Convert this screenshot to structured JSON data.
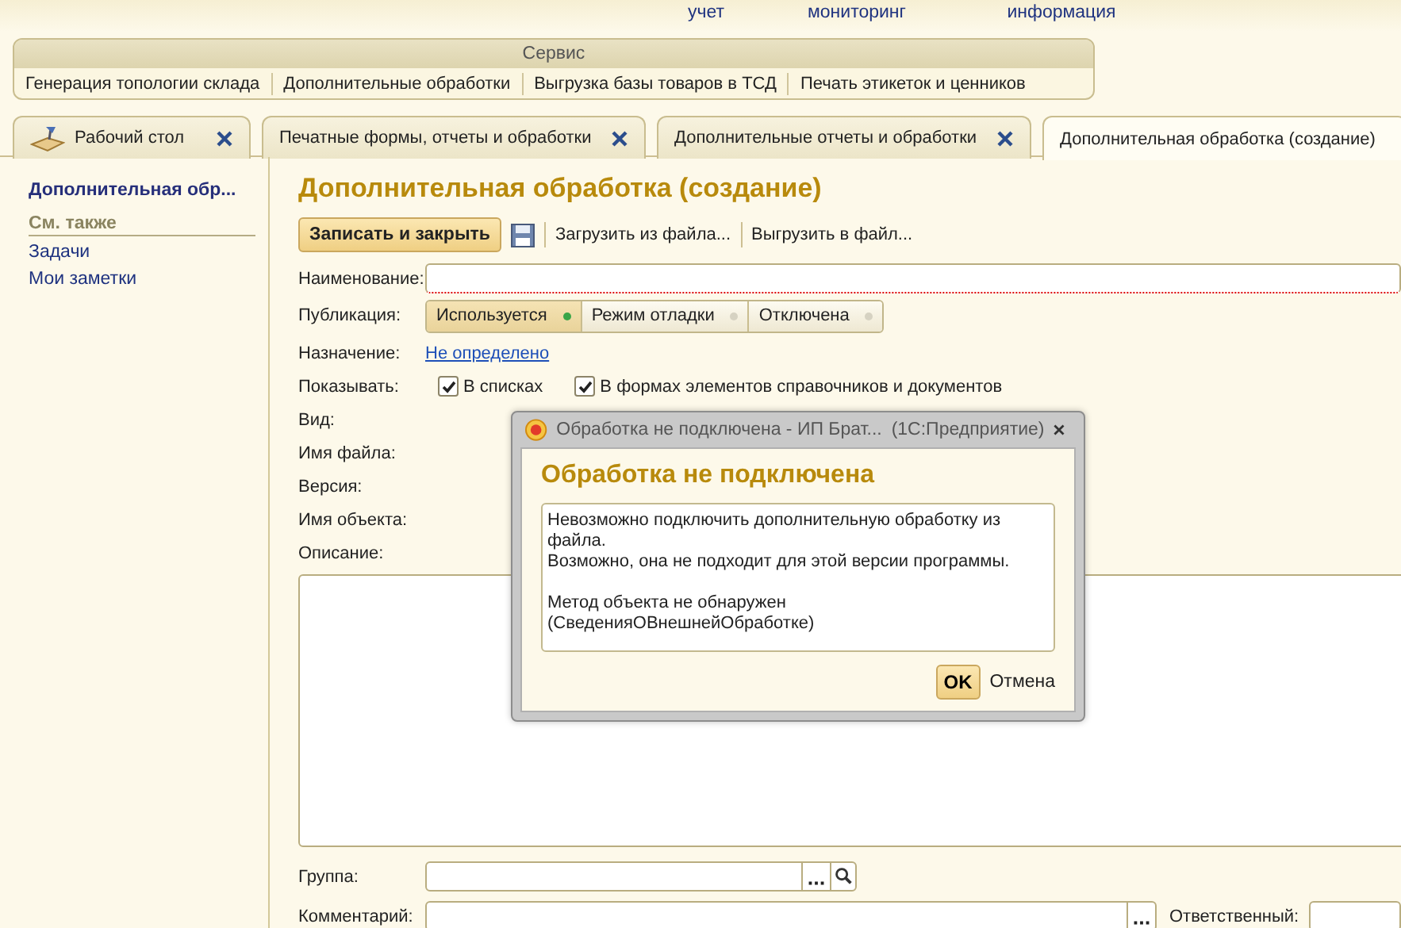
{
  "top_menu": [
    {
      "label": "учет"
    },
    {
      "label": "мониторинг"
    },
    {
      "label": "информация"
    }
  ],
  "service_panel": {
    "title": "Сервис",
    "items": [
      "Генерация топологии склада",
      "Дополнительные обработки",
      "Выгрузка базы товаров в ТСД",
      "Печать этикеток и ценников"
    ]
  },
  "tabs": [
    {
      "label": "Рабочий стол",
      "kind": "desktop",
      "selected": false,
      "closable": true
    },
    {
      "label": "Печатные формы, отчеты и обработки",
      "kind": "form",
      "selected": false,
      "closable": true
    },
    {
      "label": "Дополнительные отчеты и обработки",
      "kind": "form",
      "selected": false,
      "closable": true
    },
    {
      "label": "Дополнительная обработка (создание)",
      "kind": "form",
      "selected": true,
      "closable": false
    }
  ],
  "sidebar": {
    "title": "Дополнительная обр...",
    "section": "См. также",
    "items": [
      "Задачи",
      "Мои заметки"
    ]
  },
  "form": {
    "title": "Дополнительная обработка (создание)",
    "toolbar": {
      "primary": "Записать и закрыть",
      "items": [
        "Загрузить из файла...",
        "Выгрузить в файл..."
      ]
    },
    "name_label": "Наименование:",
    "publication": {
      "label": "Публикация:",
      "options": [
        {
          "label": "Используется",
          "selected": true
        },
        {
          "label": "Режим отладки",
          "selected": false
        },
        {
          "label": "Отключена",
          "selected": false
        }
      ]
    },
    "purpose": {
      "label": "Назначение:",
      "value": "Не определено"
    },
    "show": {
      "label": "Показывать:",
      "options": [
        {
          "label": "В списках",
          "checked": true
        },
        {
          "label": "В формах элементов справочников и документов",
          "checked": true
        }
      ]
    },
    "info_labels": [
      "Вид:",
      "Имя файла:",
      "Версия:",
      "Имя объекта:"
    ],
    "description_label": "Описание:",
    "group_label": "Группа:",
    "comment_label": "Комментарий:",
    "responsible_label": "Ответственный:"
  },
  "dialog": {
    "title": "Обработка не подключена - ИП Брат...",
    "app": "(1С:Предприятие)",
    "heading": "Обработка не подключена",
    "message": "Невозможно подключить дополнительную обработку из файла.\nВозможно, она не подходит для этой версии программы.\n\nМетод объекта не обнаружен\n(СведенияОВнешнейОбработке)",
    "ok": "OK",
    "cancel": "Отмена"
  }
}
